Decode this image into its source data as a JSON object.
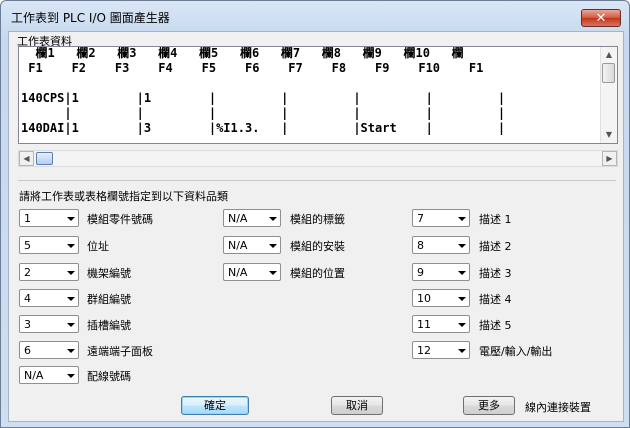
{
  "window": {
    "title": "工作表到 PLC I/O 圖面產生器",
    "close_glyph": "✕"
  },
  "worksheet": {
    "label": "工作表資料",
    "grid_lines": [
      "  欄1   欄2   欄3   欄4   欄5   欄6   欄7   欄8   欄9   欄10   欄",
      " F1    F2    F3    F4    F5    F6    F7    F8    F9    F10    F1",
      "",
      "140CPS|1        |1        |         |         |         |         |",
      "      |         |         |         |         |         |         |",
      "140DAI|1        |3        |%I1.3.   |         |Start    |         |"
    ]
  },
  "section_label": "請將工作表或表格欄號指定到以下資料品類",
  "fields_col1": [
    {
      "value": "1",
      "label": "模組零件號碼"
    },
    {
      "value": "5",
      "label": "位址"
    },
    {
      "value": "2",
      "label": "機架編號"
    },
    {
      "value": "4",
      "label": "群組編號"
    },
    {
      "value": "3",
      "label": "插槽編號"
    },
    {
      "value": "6",
      "label": "遠端端子面板"
    },
    {
      "value": "N/A",
      "label": "配線號碼"
    }
  ],
  "fields_col2": [
    {
      "value": "N/A",
      "label": "模組的標籤"
    },
    {
      "value": "N/A",
      "label": "模組的安裝"
    },
    {
      "value": "N/A",
      "label": "模組的位置"
    }
  ],
  "fields_col3": [
    {
      "value": "7",
      "label": "描述 1"
    },
    {
      "value": "8",
      "label": "描述 2"
    },
    {
      "value": "9",
      "label": "描述 3"
    },
    {
      "value": "10",
      "label": "描述 4"
    },
    {
      "value": "11",
      "label": "描述 5"
    },
    {
      "value": "12",
      "label": "電壓/輸入/輸出"
    }
  ],
  "buttons": {
    "ok": "確定",
    "cancel": "取消",
    "more": "更多"
  },
  "inline_connect_label": "線內連接裝置"
}
